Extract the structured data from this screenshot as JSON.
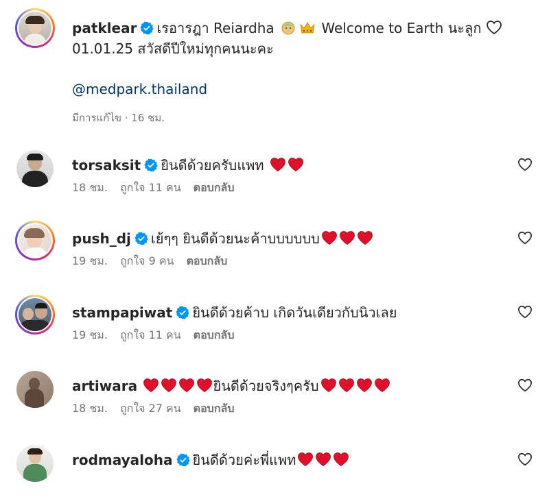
{
  "post": {
    "username": "patklear",
    "caption_part1": "เรอารฎา Reiardha",
    "caption_part2": "Welcome to Earth นะลูก",
    "caption_line2": "01.01.25 สวัสดีปีใหม่ทุกคนนะคะ",
    "mention": "@medpark.thailand",
    "meta": "มีการแก้ไข · 16 ชม."
  },
  "comments": [
    {
      "username": "torsaksit",
      "text": "ยินดีด้วยครับแพท",
      "time": "18 ชม.",
      "likes": "ถูกใจ 11 คน",
      "reply": "ตอบกลับ"
    },
    {
      "username": "push_dj",
      "text": "เย้ๆๆ ยินดีด้วยนะค้าบบบบบบ",
      "time": "19 ชม.",
      "likes": "ถูกใจ 9 คน",
      "reply": "ตอบกลับ"
    },
    {
      "username": "stampapiwat",
      "text": "ยินดีด้วยค้าบ เกิดวันเดียวกับนิวเลย",
      "time": "19 ชม.",
      "likes": "ถูกใจ 11 คน",
      "reply": "ตอบกลับ"
    },
    {
      "username": "artiwara",
      "text": "ยินดีด้วยจริงๆครับ",
      "time": "18 ชม.",
      "likes": "ถูกใจ 27 คน",
      "reply": "ตอบกลับ"
    },
    {
      "username": "rodmayaloha",
      "text": "ยินดีด้วยค่ะพี่แพท",
      "time": "",
      "likes": "",
      "reply": ""
    }
  ],
  "icons": {
    "verified": "verified-badge-icon",
    "heart": "red-heart-emoji",
    "like": "heart-outline-icon"
  },
  "colors": {
    "verified": "#0095f6",
    "heart_red": "#e0102a",
    "mention": "#00376b",
    "meta_gray": "#737373"
  }
}
